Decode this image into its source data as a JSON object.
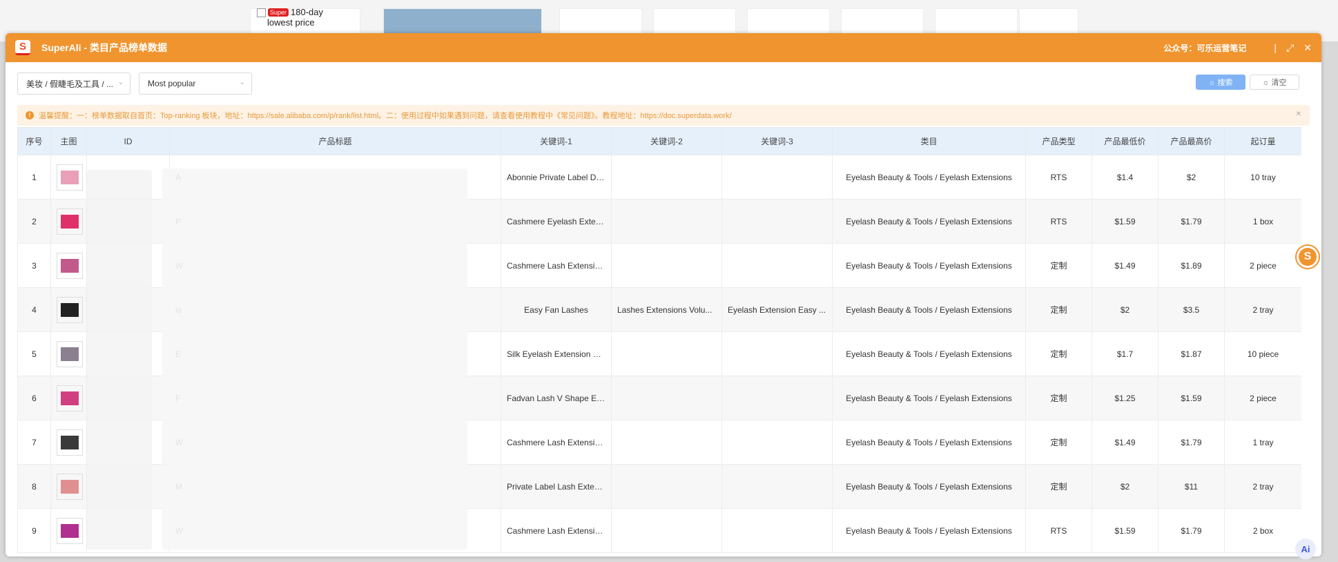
{
  "background": {
    "badge": "Super",
    "price_text": "180-day lowest price"
  },
  "window": {
    "title": "SuperAli - 类目产品榜单数据",
    "public_account": "公众号：可乐运营笔记",
    "logo_letter": "S"
  },
  "toolbar": {
    "category_value": "美妆 / 假睫毛及工具 / ...",
    "sort_value": "Most popular",
    "search_label": "☼ 搜索",
    "clear_label": "☼ 清空"
  },
  "notice": {
    "text": "温馨提醒：一：榜单数据取自首页：Top-ranking 板块，地址：https://sale.alibaba.com/p/rank/list.html。二：使用过程中如果遇到问题，请查看使用教程中《常见问题》。教程地址：https://doc.superdata.work/"
  },
  "table": {
    "headers": [
      "序号",
      "主图",
      "ID",
      "产品标题",
      "关键词-1",
      "关键词-2",
      "关键词-3",
      "类目",
      "产品类型",
      "产品最低价",
      "产品最高价",
      "起订量"
    ],
    "rows": [
      {
        "no": "1",
        "title": "A",
        "kw1": "Abonnie Private Label Da...",
        "kw2": "",
        "kw3": "",
        "cat": "Eyelash Beauty & Tools / Eyelash Extensions",
        "type": "RTS",
        "min": "$1.4",
        "max": "$2",
        "moq": "10 tray",
        "thumb": "#e8a0b8"
      },
      {
        "no": "2",
        "title": "P",
        "kw1": "Cashmere Eyelash Exten...",
        "kw2": "",
        "kw3": "",
        "cat": "Eyelash Beauty & Tools / Eyelash Extensions",
        "type": "RTS",
        "min": "$1.59",
        "max": "$1.79",
        "moq": "1 box",
        "thumb": "#e0306a"
      },
      {
        "no": "3",
        "title": "W",
        "kw1": "Cashmere Lash Extensio...",
        "kw2": "",
        "kw3": "",
        "cat": "Eyelash Beauty & Tools / Eyelash Extensions",
        "type": "定制",
        "min": "$1.49",
        "max": "$1.89",
        "moq": "2 piece",
        "thumb": "#c05a8a"
      },
      {
        "no": "4",
        "title": "la",
        "kw1": "Easy Fan Lashes",
        "kw2": "Lashes Extensions Volu...",
        "kw3": "Eyelash Extension Easy ...",
        "cat": "Eyelash Beauty & Tools / Eyelash Extensions",
        "type": "定制",
        "min": "$2",
        "max": "$3.5",
        "moq": "2 tray",
        "thumb": "#222222"
      },
      {
        "no": "5",
        "title": "E",
        "kw1": "Silk Eyelash Extension Pr...",
        "kw2": "",
        "kw3": "",
        "cat": "Eyelash Beauty & Tools / Eyelash Extensions",
        "type": "定制",
        "min": "$1.7",
        "max": "$1.87",
        "moq": "10 piece",
        "thumb": "#8a8090"
      },
      {
        "no": "6",
        "title": "F",
        "kw1": "Fadvan Lash V Shape Elli...",
        "kw2": "",
        "kw3": "",
        "cat": "Eyelash Beauty & Tools / Eyelash Extensions",
        "type": "定制",
        "min": "$1.25",
        "max": "$1.59",
        "moq": "2 piece",
        "thumb": "#d04080"
      },
      {
        "no": "7",
        "title": "W",
        "kw1": "Cashmere Lash Extensio...",
        "kw2": "",
        "kw3": "",
        "cat": "Eyelash Beauty & Tools / Eyelash Extensions",
        "type": "定制",
        "min": "$1.49",
        "max": "$1.79",
        "moq": "1 tray",
        "thumb": "#3a3a3a"
      },
      {
        "no": "8",
        "title": "M",
        "kw1": "Private Label Lash Exten...",
        "kw2": "",
        "kw3": "",
        "cat": "Eyelash Beauty & Tools / Eyelash Extensions",
        "type": "定制",
        "min": "$2",
        "max": "$11",
        "moq": "2 tray",
        "thumb": "#e09090"
      },
      {
        "no": "9",
        "title": "W",
        "kw1": "Cashmere Lash Extensio...",
        "kw2": "",
        "kw3": "",
        "cat": "Eyelash Beauty & Tools / Eyelash Extensions",
        "type": "RTS",
        "min": "$1.59",
        "max": "$1.79",
        "moq": "2 box",
        "thumb": "#b03090"
      }
    ]
  },
  "floating": {
    "s_letter": "S",
    "ai_label": "Ai"
  },
  "colors": {
    "brand_orange": "#f0942f",
    "header_blue": "#e6f0fb",
    "search_blue": "#7fb3f5"
  }
}
